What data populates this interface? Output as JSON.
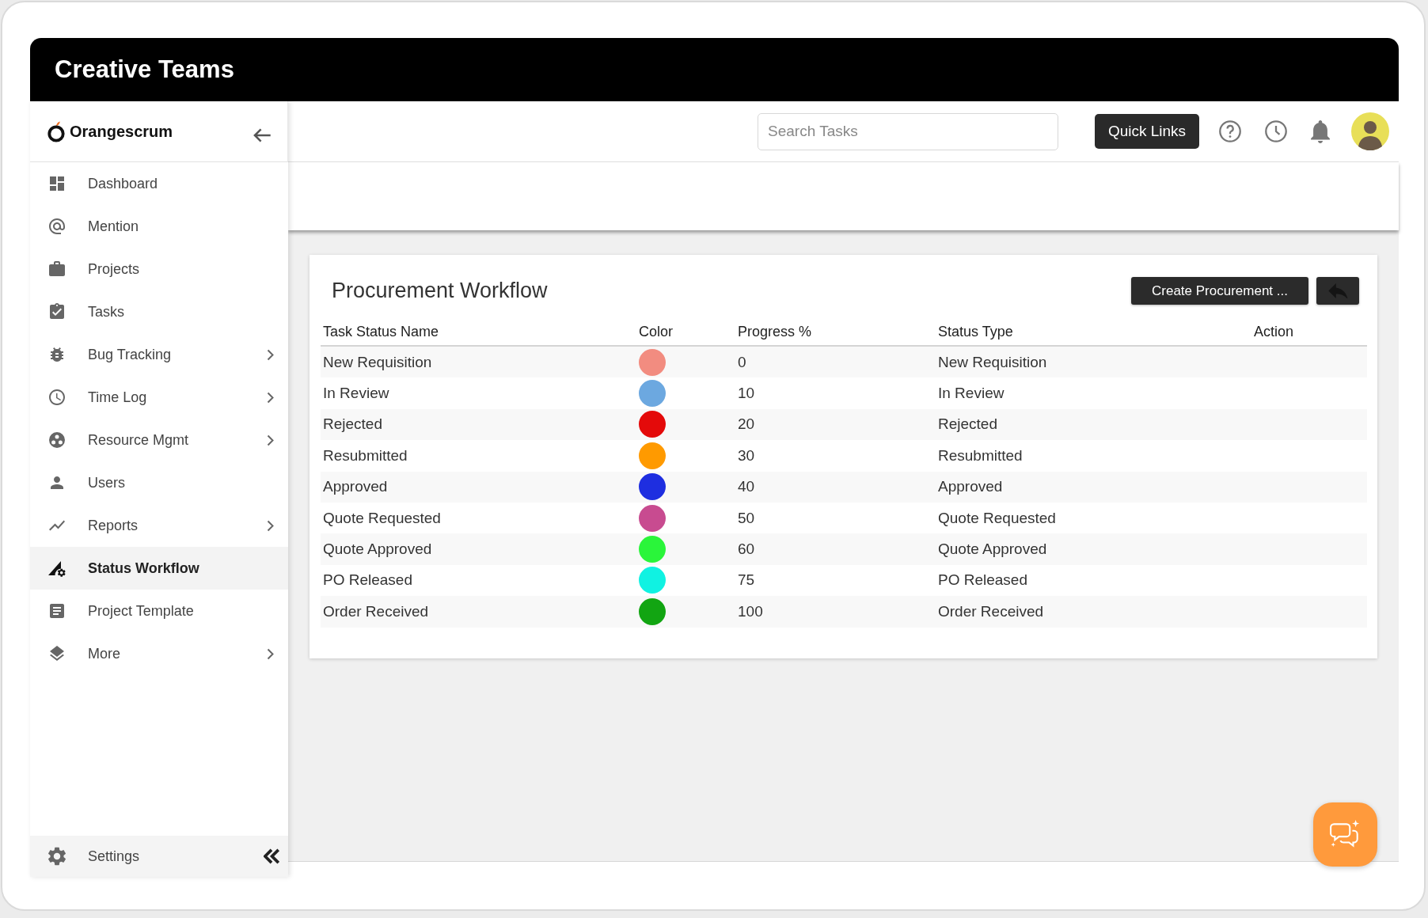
{
  "window": {
    "title": "Creative Teams"
  },
  "sidebar": {
    "brand": "Orangescrum",
    "items": [
      {
        "label": "Dashboard",
        "has_submenu": false,
        "selected": false
      },
      {
        "label": "Mention",
        "has_submenu": false,
        "selected": false
      },
      {
        "label": "Projects",
        "has_submenu": false,
        "selected": false
      },
      {
        "label": "Tasks",
        "has_submenu": false,
        "selected": false
      },
      {
        "label": "Bug Tracking",
        "has_submenu": true,
        "selected": false
      },
      {
        "label": "Time Log",
        "has_submenu": true,
        "selected": false
      },
      {
        "label": "Resource Mgmt",
        "has_submenu": true,
        "selected": false
      },
      {
        "label": "Users",
        "has_submenu": false,
        "selected": false
      },
      {
        "label": "Reports",
        "has_submenu": true,
        "selected": false
      },
      {
        "label": "Status Workflow",
        "has_submenu": false,
        "selected": true
      },
      {
        "label": "Project Template",
        "has_submenu": false,
        "selected": false
      },
      {
        "label": "More",
        "has_submenu": true,
        "selected": false
      }
    ],
    "bottom_item": {
      "label": "Settings"
    }
  },
  "topbar": {
    "search": {
      "placeholder": "Search Tasks"
    },
    "quick_links_button": "Quick Links"
  },
  "panel": {
    "title": "Procurement Workflow",
    "create_button": "Create Procurement ...",
    "table": {
      "columns": [
        "Task Status Name",
        "Color",
        "Progress %",
        "Status Type",
        "Action"
      ],
      "rows": [
        {
          "name": "New Requisition",
          "color": "#f28c80",
          "progress": "0",
          "status_type": "New Requisition"
        },
        {
          "name": "In Review",
          "color": "#6ca8e0",
          "progress": "10",
          "status_type": "In Review"
        },
        {
          "name": "Rejected",
          "color": "#e40a0a",
          "progress": "20",
          "status_type": "Rejected"
        },
        {
          "name": "Resubmitted",
          "color": "#ff9a00",
          "progress": "30",
          "status_type": "Resubmitted"
        },
        {
          "name": "Approved",
          "color": "#1e2ee0",
          "progress": "40",
          "status_type": "Approved"
        },
        {
          "name": "Quote Requested",
          "color": "#c84b90",
          "progress": "50",
          "status_type": "Quote Requested"
        },
        {
          "name": "Quote Approved",
          "color": "#2af53a",
          "progress": "60",
          "status_type": "Quote Approved"
        },
        {
          "name": "PO Released",
          "color": "#10f2e2",
          "progress": "75",
          "status_type": "PO Released"
        },
        {
          "name": "Order Received",
          "color": "#12a512",
          "progress": "100",
          "status_type": "Order Received"
        }
      ]
    }
  }
}
